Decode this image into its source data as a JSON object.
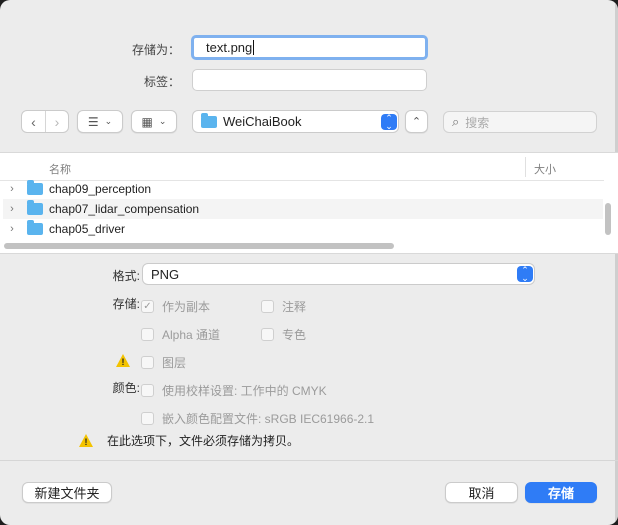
{
  "save_as": {
    "label": "存储为：",
    "value": "text.png"
  },
  "tags": {
    "label": "标签：",
    "value": ""
  },
  "toolbar": {
    "back_icon": "chevron-left-icon",
    "forward_icon": "chevron-right-icon",
    "list_view_icon": "list-icon",
    "grid_view_icon": "grid-icon",
    "location": "WeiChaiBook",
    "search_placeholder": "搜索"
  },
  "browser": {
    "col_name": "名称",
    "col_size": "大小",
    "rows": [
      {
        "name": "chap09_perception"
      },
      {
        "name": "chap07_lidar_compensation"
      },
      {
        "name": "chap05_driver"
      }
    ]
  },
  "options": {
    "format_label": "格式:",
    "format_value": "PNG",
    "storage_label": "存储:",
    "as_copy": "作为副本",
    "annotations": "注释",
    "alpha": "Alpha 通道",
    "spot_color": "专色",
    "layers": "图层",
    "color_label": "颜色:",
    "proof_setup": "使用校样设置: 工作中的 CMYK",
    "embed_profile": "嵌入颜色配置文件: sRGB IEC61966-2.1",
    "warning": "在此选项下，文件必须存储为拷贝。"
  },
  "footer": {
    "new_folder": "新建文件夹",
    "cancel": "取消",
    "save": "存储"
  },
  "colors": {
    "accent": "#2f7cf6",
    "folder": "#5ab4ee",
    "warning": "#f3c300"
  }
}
